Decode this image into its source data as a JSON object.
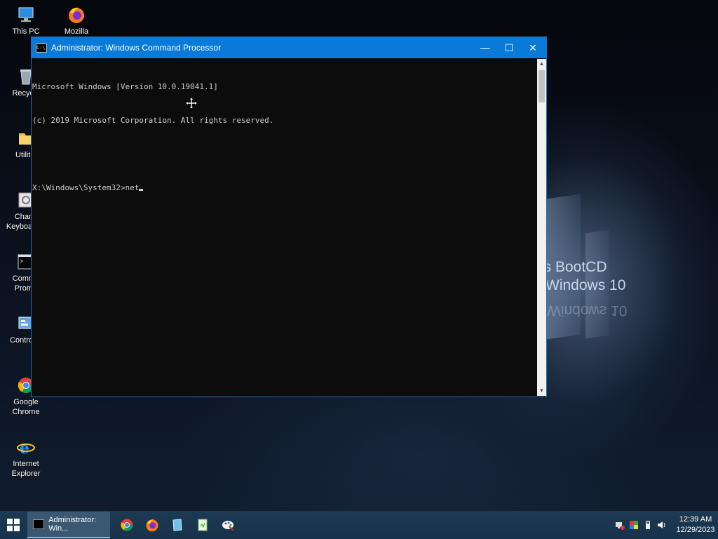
{
  "desktop": {
    "icons": [
      {
        "label": "This PC",
        "icon": "this-pc-icon"
      },
      {
        "label": "Mozilla Firefox",
        "icon": "firefox-icon"
      },
      {
        "label": "Recycle",
        "icon": "recycle-bin-icon"
      },
      {
        "label": "Utilitie",
        "icon": "folder-icon"
      },
      {
        "label": "Chang\nKeyboard L",
        "icon": "keyboard-settings-icon"
      },
      {
        "label": "Comma\nPromp",
        "icon": "command-prompt-icon"
      },
      {
        "label": "Control P",
        "icon": "control-panel-icon"
      },
      {
        "label": "Google Chrome",
        "icon": "chrome-icon"
      },
      {
        "label": "Internet Explorer",
        "icon": "internet-explorer-icon"
      }
    ],
    "wallpaper_text": [
      "en’s BootCD",
      "Windows 10"
    ],
    "wallpaper_reflection": "Windows 10"
  },
  "window": {
    "title": "Administrator: Windows Command Processor",
    "icon_text": "C:\\.",
    "buttons": {
      "minimize": "—",
      "maximize": "☐",
      "close": "✕"
    },
    "console_lines": [
      "Microsoft Windows [Version 10.0.19041.1]",
      "(c) 2019 Microsoft Corporation. All rights reserved.",
      "",
      "X:\\Windows\\System32>net"
    ],
    "scroll_up": "▲",
    "scroll_down": "▼"
  },
  "taskbar": {
    "active_task_label": "Administrator: Win...",
    "pinned": [
      "chrome-icon",
      "firefox-icon",
      "notepad-icon",
      "file-icon",
      "paint-icon"
    ],
    "clock_time": "12:39 AM",
    "clock_date": "12/29/2023"
  },
  "colors": {
    "titlebar": "#0a7ad8",
    "console_bg": "#0c0c0c",
    "console_text": "#cccccc",
    "taskbar": "#1d3a52"
  }
}
